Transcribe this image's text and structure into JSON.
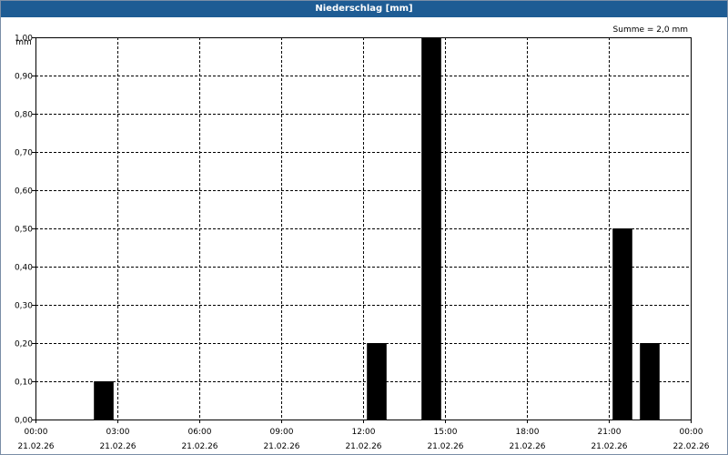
{
  "window": {
    "title": "Niederschlag [mm]"
  },
  "chart_data": {
    "type": "bar",
    "title": "Niederschlag [mm]",
    "ylabel": "mm",
    "xlabel": "",
    "annotation": "Summe = 2,0 mm",
    "ylim": [
      0,
      1.0
    ],
    "xlim": [
      "21.02.26 00:00",
      "22.02.26 00:00"
    ],
    "grid": true,
    "bar_color": "#000000",
    "y_ticks": [
      "0,00",
      "0,10",
      "0,20",
      "0,30",
      "0,40",
      "0,50",
      "0,60",
      "0,70",
      "0,80",
      "0,90",
      "1,00"
    ],
    "x_ticks": [
      {
        "time": "00:00",
        "date": "21.02.26"
      },
      {
        "time": "03:00",
        "date": "21.02.26"
      },
      {
        "time": "06:00",
        "date": "21.02.26"
      },
      {
        "time": "09:00",
        "date": "21.02.26"
      },
      {
        "time": "12:00",
        "date": "21.02.26"
      },
      {
        "time": "15:00",
        "date": "21.02.26"
      },
      {
        "time": "18:00",
        "date": "21.02.26"
      },
      {
        "time": "21:00",
        "date": "21.02.26"
      },
      {
        "time": "00:00",
        "date": "22.02.26"
      }
    ],
    "bars": [
      {
        "start": "02:00",
        "end": "03:00",
        "value": 0.1
      },
      {
        "start": "12:00",
        "end": "13:00",
        "value": 0.2
      },
      {
        "start": "14:00",
        "end": "15:00",
        "value": 1.0
      },
      {
        "start": "21:00",
        "end": "22:00",
        "value": 0.5
      },
      {
        "start": "22:00",
        "end": "23:00",
        "value": 0.2
      }
    ]
  }
}
